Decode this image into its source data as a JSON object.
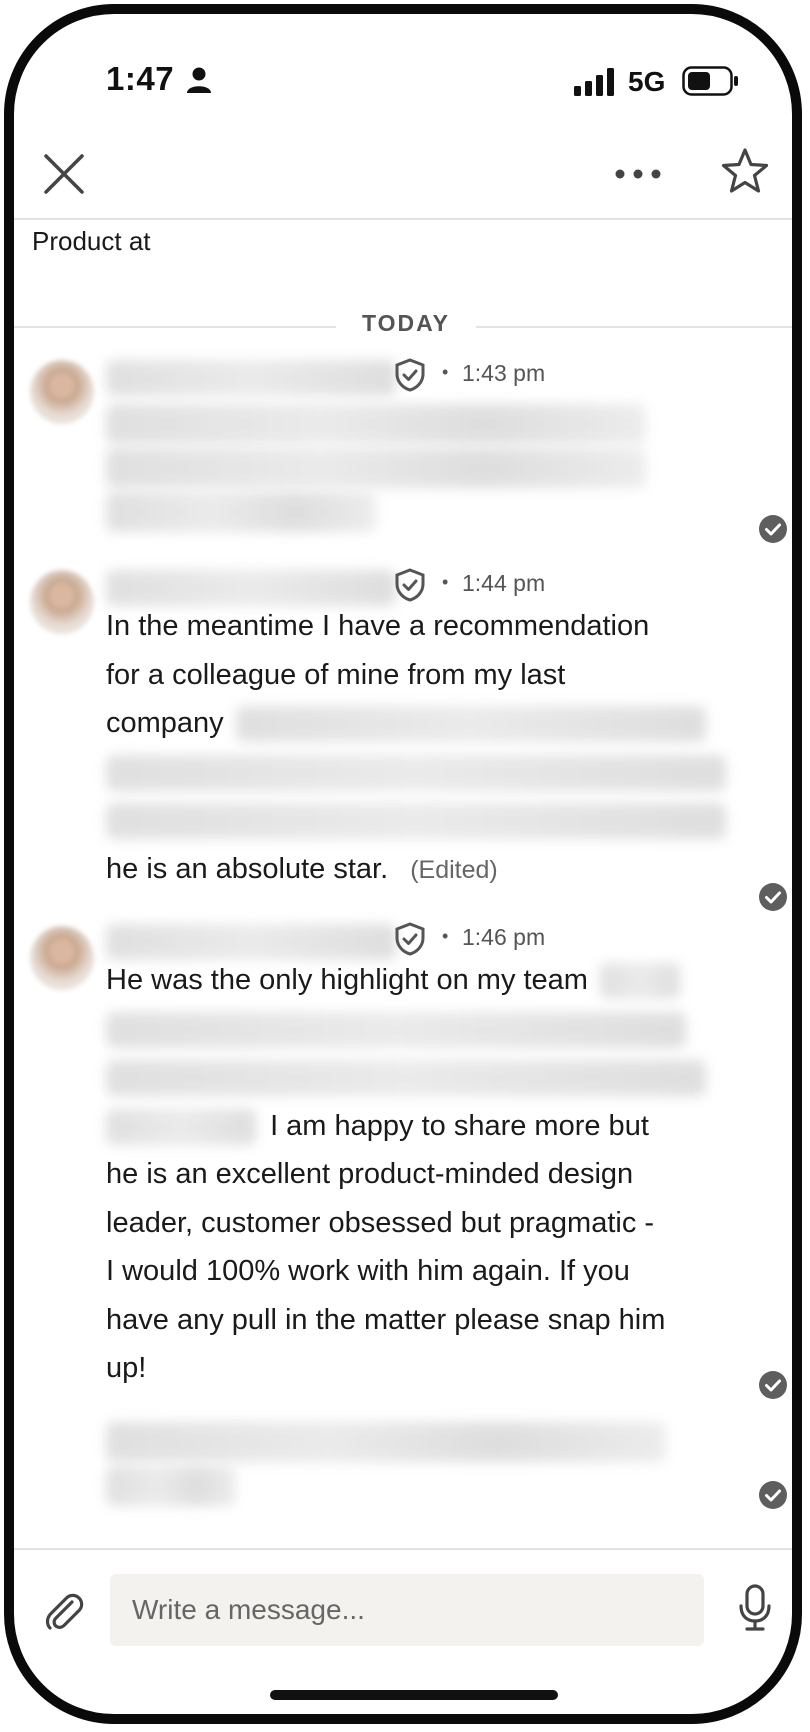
{
  "status_bar": {
    "time": "1:47",
    "network": "5G"
  },
  "header": {
    "subtitle": "Product at"
  },
  "date_divider": {
    "label": "TODAY"
  },
  "messages": [
    {
      "time": "1:43 pm",
      "text_visible": []
    },
    {
      "time": "1:44 pm",
      "text_line1": "In the meantime I have a recommendation",
      "text_line2": "for a colleague of mine from my last",
      "text_line3": "company",
      "text_line6": "he is an absolute star.",
      "edited_label": "(Edited)"
    },
    {
      "time": "1:46 pm",
      "text_line1": "He was the only highlight on my team",
      "text_line4": "I am happy to share more but",
      "text_line5": "he is an excellent product-minded design",
      "text_line6": "leader, customer obsessed but pragmatic -",
      "text_line7": "I would 100% work with him again. If you",
      "text_line8": "have any pull in the matter please snap him",
      "text_line9": "up!"
    }
  ],
  "composer": {
    "placeholder": "Write a message..."
  },
  "icons": {
    "close": "close-icon",
    "more": "more-icon",
    "star": "star-icon",
    "verified": "shield-check-icon",
    "read": "check-circle-icon",
    "attach": "paperclip-icon",
    "mic": "microphone-icon"
  }
}
